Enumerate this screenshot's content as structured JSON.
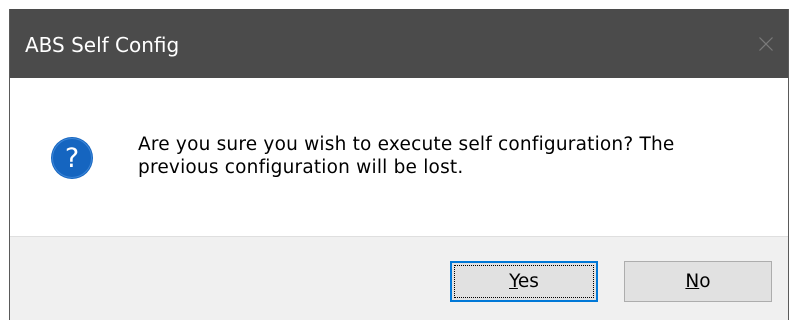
{
  "window": {
    "title": "ABS Self Config"
  },
  "icons": {
    "close": "close-icon",
    "question": "question-icon"
  },
  "message": {
    "line1": "Are you sure you wish to execute self configuration? The",
    "line2": "previous configuration will be lost."
  },
  "buttons": {
    "yes": {
      "mnemonic": "Y",
      "rest": "es"
    },
    "no": {
      "mnemonic": "N",
      "rest": "o"
    }
  },
  "colors": {
    "titlebar": "#4b4b4b",
    "question_icon": "#1565c0",
    "focus_border": "#0078d7",
    "footer": "#f0f0f0"
  }
}
